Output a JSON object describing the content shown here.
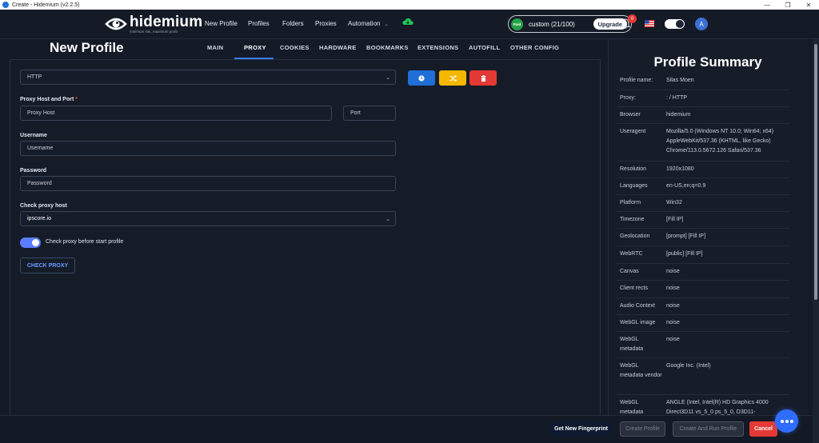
{
  "window": {
    "title": "Create - Hidemium (v2.2.5)",
    "controls": [
      "—",
      "❐",
      "✕"
    ]
  },
  "nav": {
    "brand": "hidemium",
    "tagline": "minimum risk, maximum profit",
    "links": [
      "New Profile",
      "Profiles",
      "Folders",
      "Proxies",
      "Automation"
    ],
    "plan_badge": "Paid",
    "plan_text": "custom (21/100)",
    "upgrade_label": "Upgrade",
    "notification_count": "0",
    "avatar_initial": "A"
  },
  "page": {
    "title": "New Profile",
    "tabs": [
      "MAIN",
      "PROXY",
      "COOKIES",
      "HARDWARE",
      "BOOKMARKS",
      "EXTENSIONS",
      "AUTOFILL",
      "OTHER CONFIG"
    ],
    "active_tab": "PROXY"
  },
  "form": {
    "proxy_type": "HTTP",
    "host_label": "Proxy Host and Port",
    "host_required_mark": "*",
    "host_placeholder": "Proxy Host",
    "port_placeholder": "Port",
    "username_label": "Username",
    "username_placeholder": "Username",
    "password_label": "Password",
    "password_placeholder": "Password",
    "check_host_label": "Check proxy host",
    "check_host_value": "ipscore.io",
    "toggle_label": "Check proxy before start profile",
    "toggle_on": true,
    "check_button": "CHECK PROXY"
  },
  "action_colors": {
    "history": "#1f6fd6",
    "shuffle": "#f5b800",
    "delete": "#e53935"
  },
  "summary": {
    "title": "Profile Summary",
    "rows": [
      {
        "k": "Profile name:",
        "v": "Silas Moen"
      },
      {
        "k": "Proxy:",
        "v": ": / HTTP"
      },
      {
        "k": "Browser",
        "v": "hidemium"
      },
      {
        "k": "Useragent",
        "v": "Mozilla/5.0 (Windows NT 10.0; Win64; x64) AppleWebKit/537.36 (KHTML, like Gecko) Chrome/113.0.5672.126 Safari/537.36"
      },
      {
        "k": "Resolution",
        "v": "1920x1080"
      },
      {
        "k": "Languages",
        "v": "en-US,en;q=0.9"
      },
      {
        "k": "Platform",
        "v": "Win32"
      },
      {
        "k": "Timezone",
        "v": "[Fill IP]"
      },
      {
        "k": "Geolocation",
        "v": "[prompt] [Fill IP]"
      },
      {
        "k": "WebRTC",
        "v": "[public] [Fill IP]"
      },
      {
        "k": "Canvas",
        "v": "noise"
      },
      {
        "k": "Client rects",
        "v": "noise"
      },
      {
        "k": "Audio Context",
        "v": "noise"
      },
      {
        "k": "WebGL image",
        "v": "noise"
      },
      {
        "k": "WebGL metadata",
        "v": "noise"
      },
      {
        "k": "WebGL metadata vendor",
        "v": "Google Inc. (Intel)"
      },
      {
        "k": "WebGL metadata",
        "v": "ANGLE (Intel, Intel(R) HD Graphics 4000 Direct3D11 vs_5_0 ps_5_0, D3D11-"
      }
    ]
  },
  "footer": {
    "fingerprint": "Get New Fingerprint",
    "create": "Create Profile",
    "create_run": "Create And Run Profile",
    "cancel": "Cancel"
  }
}
